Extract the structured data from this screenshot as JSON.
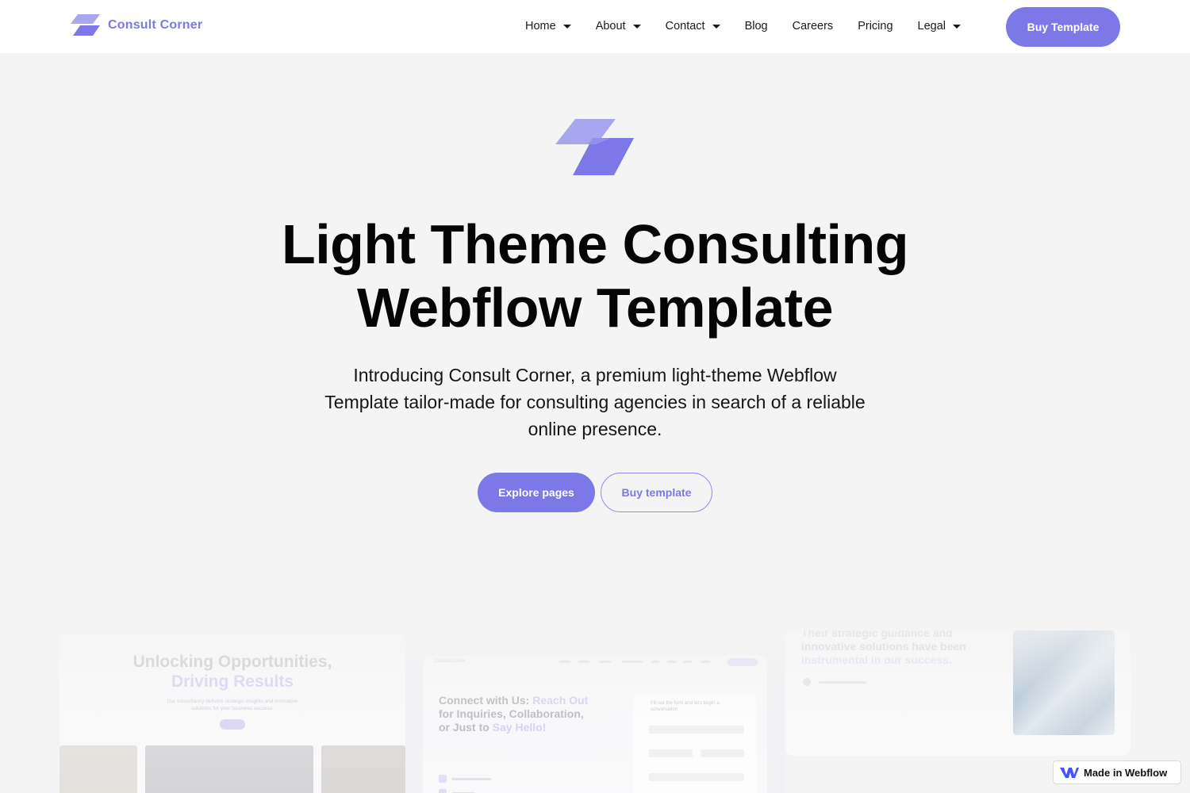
{
  "nav": {
    "brand": "Consult Corner",
    "items": [
      {
        "label": "Home",
        "dropdown": true
      },
      {
        "label": "About",
        "dropdown": true
      },
      {
        "label": "Contact",
        "dropdown": true
      },
      {
        "label": "Blog",
        "dropdown": false
      },
      {
        "label": "Careers",
        "dropdown": false
      },
      {
        "label": "Pricing",
        "dropdown": false
      },
      {
        "label": "Legal",
        "dropdown": true
      }
    ],
    "cta": "Buy Template"
  },
  "hero": {
    "title_line1": "Light Theme Consulting",
    "title_line2": "Webflow Template",
    "subtitle": "Introducing Consult Corner, a premium light-theme Webflow Template tailor-made for consulting agencies in search of a reliable online presence.",
    "primary_button": "Explore pages",
    "secondary_button": "Buy template"
  },
  "preview": {
    "card_a": {
      "heading_line1": "Unlocking Opportunities,",
      "heading_line2": "Driving Results",
      "paragraph": "Our consultancy delivers strategic insights and innovative solutions for your business success."
    },
    "card_b": {
      "brand": "Consult Corner",
      "heading_part1": "Connect with Us: ",
      "heading_hl1": "Reach Out",
      "heading_part2": " for Inquiries, Collaboration, or Just to ",
      "heading_hl2": "Say Hello!",
      "form_title": "Fill out the form and let's begin a conversation"
    },
    "card_c": {
      "text_part1": "Their strategic guidance and innovative solutions have been ",
      "text_hl": "instrumental in our success."
    }
  },
  "badge": {
    "label": "Made in Webflow"
  },
  "colors": {
    "accent": "#7c78e8",
    "background": "#f4f4f4",
    "text": "#0a0a0a"
  }
}
